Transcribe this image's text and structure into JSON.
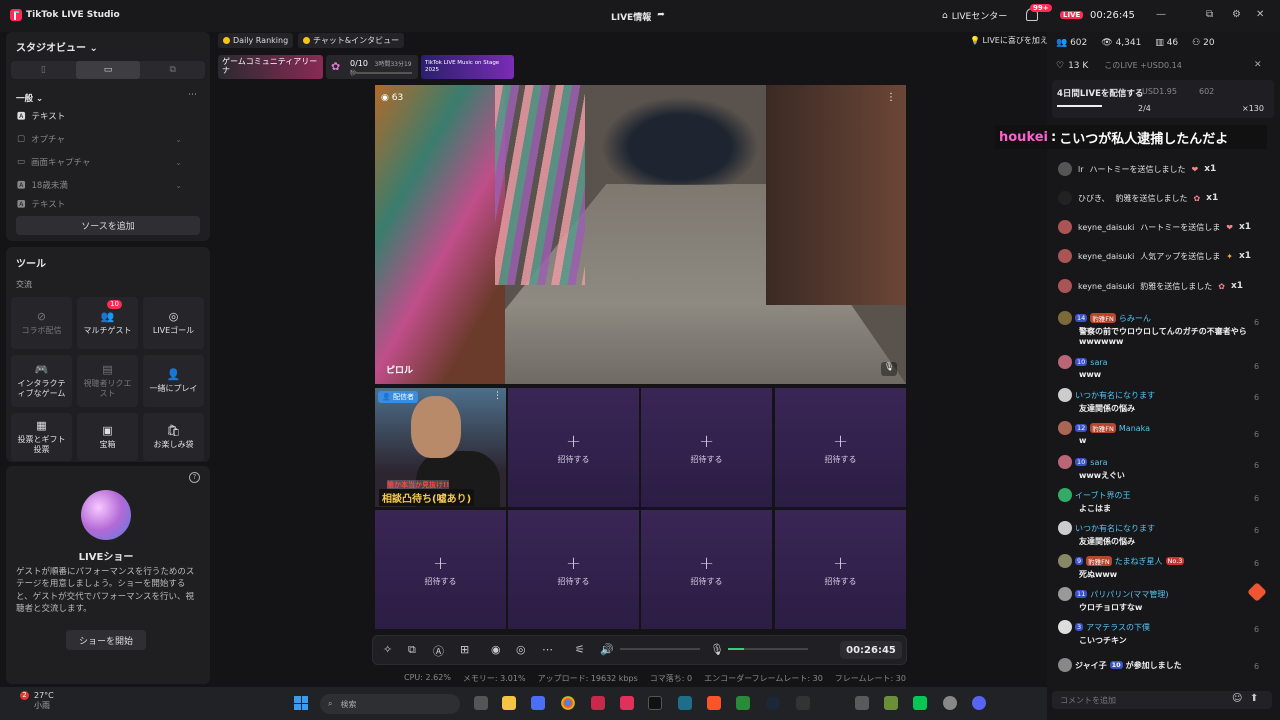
{
  "app": {
    "title": "TikTok LIVE Studio"
  },
  "header": {
    "center_title": "LIVE情報",
    "live_center": "LIVEセンター",
    "notif_badge": "99+",
    "live_label": "LIVE",
    "timer": "00:26:45"
  },
  "left": {
    "studio_view": "スタジオビュー",
    "general": "一般",
    "sources": [
      "テキスト",
      "オプチャ",
      "画面キャプチャ",
      "18歳未満",
      "テキスト"
    ],
    "add_source": "ソースを追加",
    "tools_title": "ツール",
    "exchange": "交流",
    "tools": [
      {
        "label": "コラボ配信",
        "icon": "link-icon",
        "dim": true
      },
      {
        "label": "マルチゲスト",
        "icon": "multi-guest-icon",
        "badge": "10"
      },
      {
        "label": "LIVEゴール",
        "icon": "target-icon"
      },
      {
        "label": "インタラクティブなゲーム",
        "icon": "gamepad-icon"
      },
      {
        "label": "視聴者リクエスト",
        "icon": "request-icon",
        "dim": true
      },
      {
        "label": "一緒にプレイ",
        "icon": "play-together-icon"
      },
      {
        "label": "投票とギフト投票",
        "icon": "poll-icon"
      },
      {
        "label": "宝箱",
        "icon": "treasure-icon"
      },
      {
        "label": "お楽しみ袋",
        "icon": "bag-icon"
      }
    ],
    "show_title": "LIVEショー",
    "show_desc": "ゲストが順番にパフォーマンスを行うためのステージを用意しましょう。ショーを開始すると、ゲストが交代でパフォーマンスを行い、視聴者と交流します。",
    "start_show": "ショーを開始"
  },
  "center": {
    "chips": [
      "Daily Ranking",
      "チャット&インタビュー"
    ],
    "banner1": "ゲームコミュニティアリーナ",
    "banner2": "0/10",
    "banner2_sub": "3時間33分19秒",
    "banner3": "TikTok LIVE Music on Stage 2025",
    "video_viewers": "63",
    "video_name": "ピロル",
    "host_tag": "配信者",
    "host_caption": "相談凸待ち(嘘あり)",
    "host_caption_top": "誰か本当か見抜け!!",
    "invite": "招待する",
    "time": "00:26:45",
    "stats": [
      "CPU: 2.62%",
      "メモリー: 3.01%",
      "アップロード: 19632 kbps",
      "コマ落ち: 0",
      "エンコーダーフレームレート: 30",
      "フレームレート: 30"
    ]
  },
  "right": {
    "live_hint": "LIVEに喜びを加え",
    "stats": [
      "602",
      "4,341",
      "46",
      "20"
    ],
    "likes": "13 K",
    "usd": "このLIVE +USD0.14",
    "card_title": "4日間LIVEを配信する",
    "card_usd": "USD1.95",
    "card_viewers": "602",
    "card_likes": "13K",
    "card_progress": "2/4",
    "card_diamonds": "×130",
    "overlay_name": "houkei",
    "overlay_text": "こいつが私人逮捕したんだよ",
    "gifts": [
      {
        "user": "lr",
        "text": "ハートミーを送信しました",
        "count": "x1"
      },
      {
        "user": "ひびき、",
        "text": "豹雅を送信しました",
        "count": "x1"
      },
      {
        "user": "keyne_daisuki",
        "text": "ハートミーを送信しま",
        "count": "x1"
      },
      {
        "user": "keyne_daisuki",
        "text": "人気アップを送信しま",
        "count": "x1"
      },
      {
        "user": "keyne_daisuki",
        "text": "豹雅を送信しました",
        "count": "x1"
      }
    ],
    "comments": [
      {
        "lv": "14",
        "fan": "豹雅FN",
        "user": "らみーん",
        "text": "警察の前でウロウロしてんのガチの不審者やらwwwwww"
      },
      {
        "lv": "10",
        "user": "sara",
        "text": "www"
      },
      {
        "user": "いつか有名になります",
        "text": "友達関係の悩み"
      },
      {
        "lv": "12",
        "fan": "豹雅FN",
        "user": "Manaka",
        "text": "w"
      },
      {
        "lv": "10",
        "user": "sara",
        "text": "wwwえぐい"
      },
      {
        "user": "イーブト界の王",
        "text": "よこはま"
      },
      {
        "user": "いつか有名になります",
        "text": "友達関係の悩み"
      },
      {
        "lv": "9",
        "fan": "豹雅FN",
        "user": "たまねぎ星人",
        "extra": "No.3",
        "text": "死ぬwww"
      },
      {
        "lv": "11",
        "user": "パリパリン(ママ管理)",
        "text": "ウロチョロすなw"
      },
      {
        "lv": "3",
        "user": "アマテラスの下僕",
        "text": "こいつチキン"
      },
      {
        "user": "ジャイ子",
        "lv": "10",
        "text": "が参加しました"
      }
    ],
    "right_nums": [
      "6",
      "6",
      "6",
      "6",
      "6",
      "6",
      "6",
      "6",
      "6",
      "6",
      "6",
      "6"
    ],
    "comment_placeholder": "コメントを追加"
  },
  "taskbar": {
    "temp": "27°C",
    "weather": "小雨",
    "notif": "2",
    "search": "検索"
  }
}
